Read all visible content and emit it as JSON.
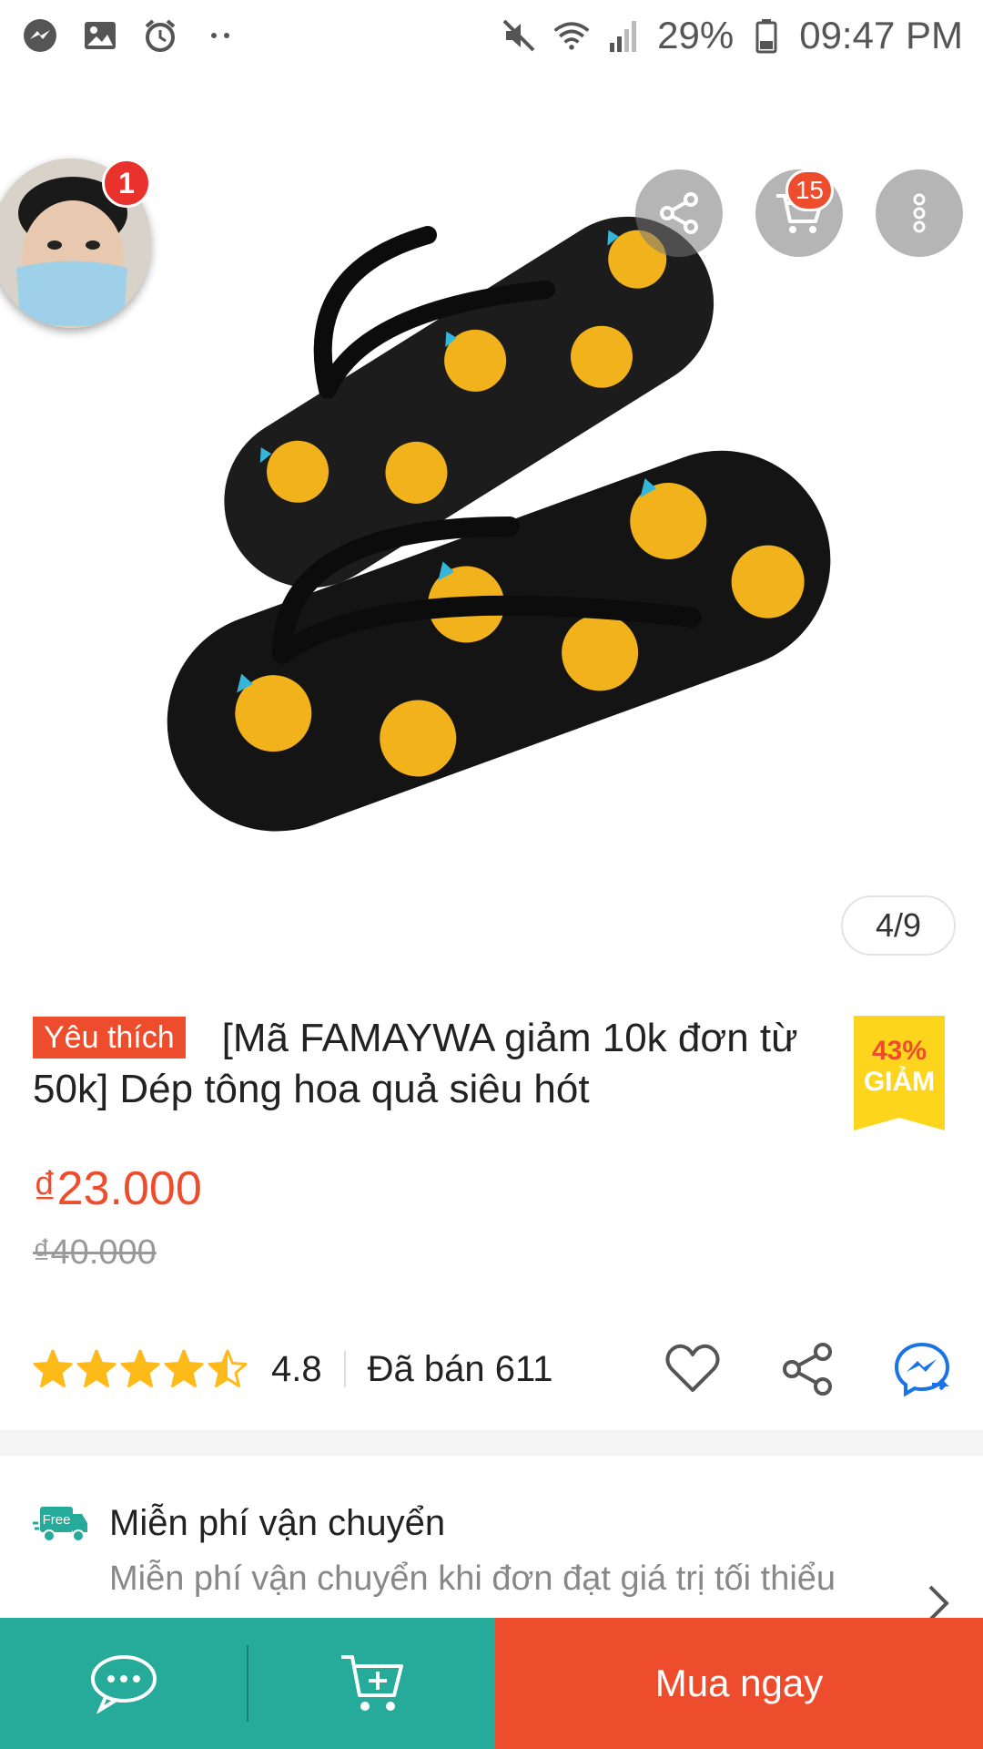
{
  "status_bar": {
    "battery_percent": "29%",
    "time": "09:47 PM",
    "left_icons": [
      "messenger-icon",
      "image-icon",
      "alarm-icon",
      "more-dots-icon"
    ],
    "right_icons": [
      "mute-icon",
      "wifi-icon",
      "signal-icon",
      "battery-icon"
    ]
  },
  "header": {
    "avatar_badge": "1",
    "cart_badge": "15",
    "actions": [
      "share-icon",
      "cart-icon",
      "more-icon"
    ]
  },
  "gallery": {
    "counter": "4/9"
  },
  "product": {
    "favorite_tag": "Yêu thích",
    "title": "[Mã FAMAYWA giảm 10k đơn từ 50k] Dép tông hoa quả siêu hót",
    "discount_percent": "43%",
    "discount_label": "GIẢM",
    "price": "₫23.000",
    "old_price": "₫40.000",
    "rating": 4.5,
    "rating_value": "4.8",
    "sold": "Đã bán 611"
  },
  "shipping": {
    "badge": "Free",
    "title": "Miễn phí vận chuyển",
    "description": "Miễn phí vận chuyển khi đơn đạt giá trị tối thiểu"
  },
  "bottom_bar": {
    "buy_now": "Mua ngay"
  },
  "colors": {
    "brand": "#ee4d2d",
    "teal": "#26aa99",
    "star": "#fdbb1a",
    "discount_bg": "#fdd51d",
    "messenger": "#1a73e8"
  }
}
